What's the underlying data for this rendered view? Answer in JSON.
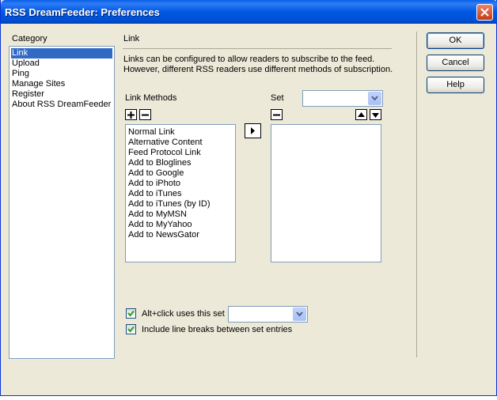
{
  "window": {
    "title": "RSS DreamFeeder: Preferences"
  },
  "category": {
    "heading": "Category",
    "items": [
      "Link",
      "Upload",
      "Ping",
      "Manage Sites",
      "Register",
      "About RSS DreamFeeder"
    ],
    "selected": 0
  },
  "section": {
    "title": "Link",
    "description_line1": "Links can be configured to allow readers to subscribe to the feed.",
    "description_line2": "However, different RSS readers use different methods of subscription."
  },
  "link_methods": {
    "heading": "Link Methods",
    "add_symbol": "+",
    "remove_symbol": "−",
    "items": [
      "Normal Link",
      "Alternative Content",
      "Feed Protocol Link",
      "Add to Bloglines",
      "Add to Google",
      "Add to iPhoto",
      "Add to iTunes",
      "Add to iTunes (by ID)",
      "Add to MyMSN",
      "Add to MyYahoo",
      "Add to NewsGator"
    ]
  },
  "set": {
    "heading": "Set",
    "selected_value": "",
    "remove_symbol": "−",
    "items": []
  },
  "options": {
    "alt_click_label": "Alt+click uses this set",
    "alt_click_checked": true,
    "alt_click_value": "",
    "line_breaks_label": "Include line breaks between set entries",
    "line_breaks_checked": true
  },
  "buttons": {
    "ok": "OK",
    "cancel": "Cancel",
    "help": "Help"
  },
  "colors": {
    "titlebar": "#0058e3",
    "selection": "#316ac5",
    "dialog_bg": "#ece9d8"
  }
}
